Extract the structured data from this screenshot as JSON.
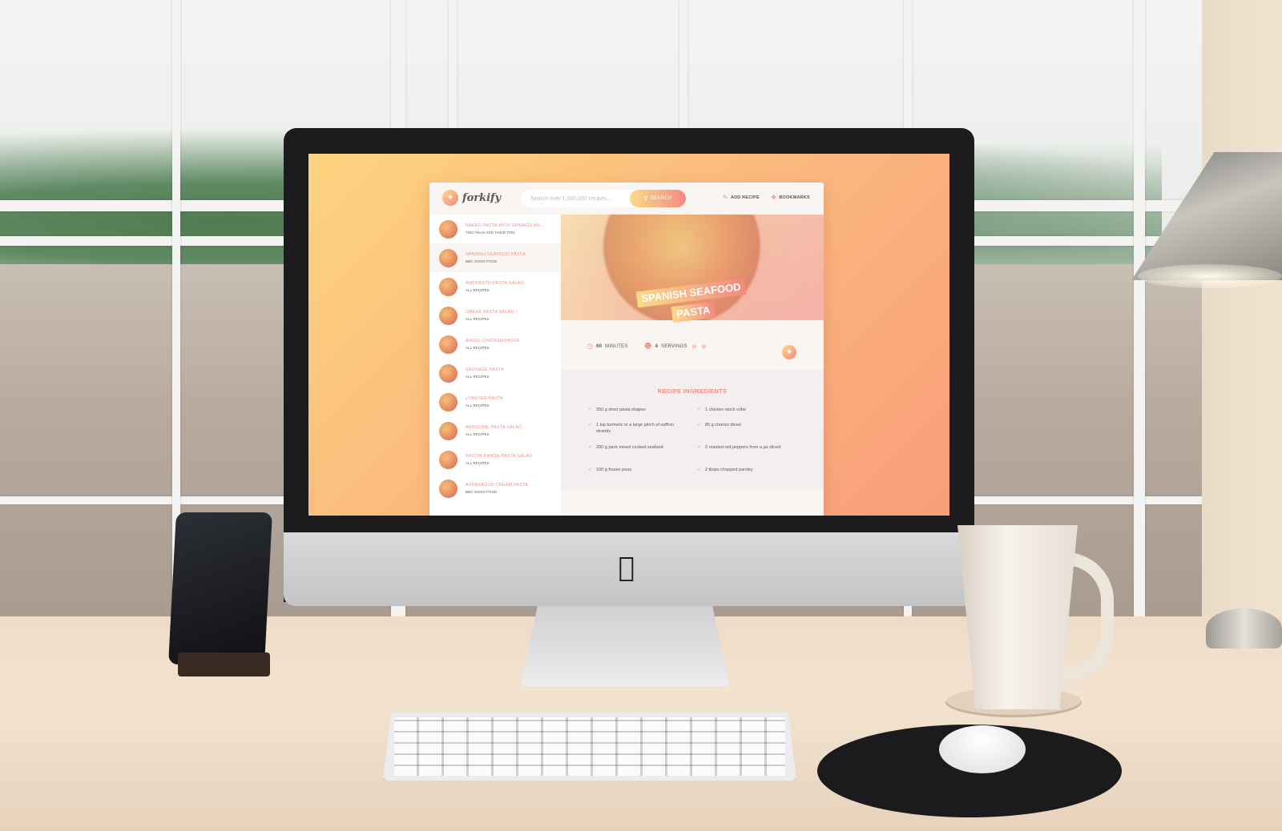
{
  "app": {
    "logo_text": "forkify",
    "search": {
      "placeholder": "Search over 1,000,000 recipes...",
      "button_label": "SEARCH"
    },
    "nav": {
      "add_recipe": "ADD RECIPE",
      "bookmarks": "BOOKMARKS"
    },
    "results": [
      {
        "title": "BAKED PASTA WITH SPINACH AN...",
        "publisher": "TWO PEAS AND THEIR POD",
        "active": false
      },
      {
        "title": "SPANISH SEAFOOD PASTA",
        "publisher": "BBC GOOD FOOD",
        "active": true
      },
      {
        "title": "ANTIPASTO PASTA SALAD",
        "publisher": "ALL RECIPES",
        "active": false
      },
      {
        "title": "GREEK PASTA SALAD I",
        "publisher": "ALL RECIPES",
        "active": false
      },
      {
        "title": "ANGEL CHICKEN PASTA",
        "publisher": "ALL RECIPES",
        "active": false
      },
      {
        "title": "SAUSAGE PASTA",
        "publisher": "ALL RECIPES",
        "active": false
      },
      {
        "title": "LOBSTER PASTA",
        "publisher": "ALL RECIPES",
        "active": false
      },
      {
        "title": "AWESOME PASTA SALAD",
        "publisher": "ALL RECIPES",
        "active": false
      },
      {
        "title": "BACON RANCH PASTA SALAD",
        "publisher": "ALL RECIPES",
        "active": false
      },
      {
        "title": "ASPARAGUS CREAM PASTA",
        "publisher": "BBC GOOD FOOD",
        "active": false
      }
    ],
    "recipe": {
      "title_line1": "SPANISH SEAFOOD",
      "title_line2": "PASTA",
      "minutes_value": "60",
      "minutes_label": "MINUTES",
      "servings_value": "4",
      "servings_label": "SERVINGS",
      "ingredients_heading": "RECIPE INGREDIENTS",
      "ingredients": [
        "350 g short pasta shapes",
        "1 chicken stock cube",
        "1 tsp turmeric or a large pinch of saffron strands",
        "85 g chorizo diced",
        "200 g pack mixed cooked seafood",
        "2 roasted red peppers from a jar sliced",
        "100 g frozen peas",
        "2 tbsps chopped parsley"
      ]
    }
  },
  "icons": {
    "logo": "fork-knife-icon",
    "search": "search-icon",
    "add_recipe": "edit-icon",
    "bookmarks": "bookmark-icon",
    "timer": "clock-icon",
    "servings": "users-icon",
    "decrease": "minus-circle-icon",
    "increase": "plus-circle-icon",
    "check": "check-icon",
    "hardware": "apple-logo-icon"
  },
  "colors": {
    "gradient_start": "#fbdb89",
    "gradient_end": "#f48982",
    "accent": "#f38e82",
    "text": "#615551",
    "panel_bg": "#f9f5f3"
  }
}
